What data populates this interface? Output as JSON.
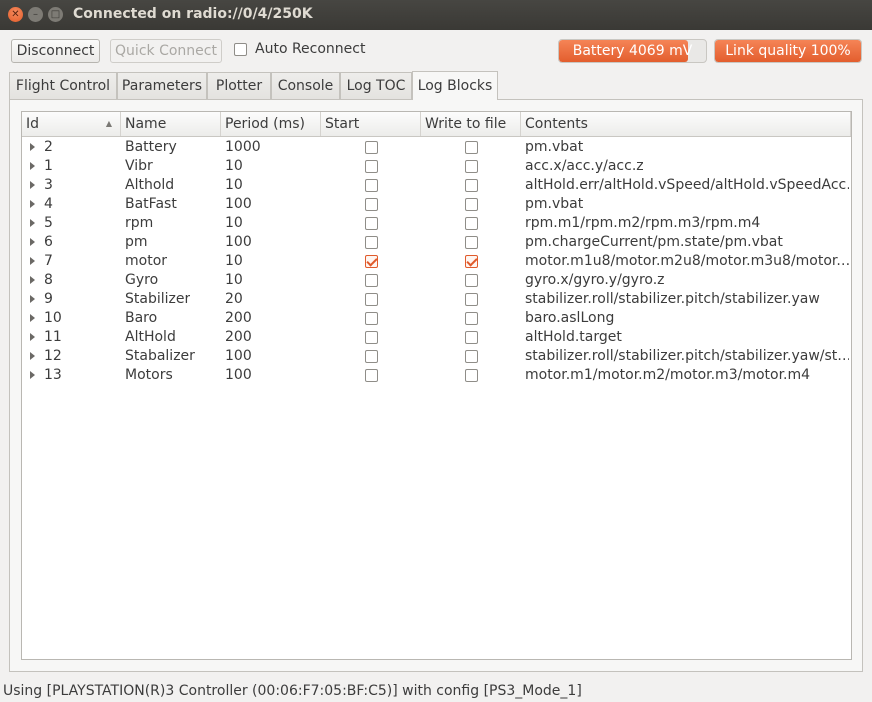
{
  "window": {
    "title": "Connected on radio://0/4/250K"
  },
  "toolbar": {
    "disconnect_label": "Disconnect",
    "quick_connect_label": "Quick Connect",
    "auto_reconnect_label": "Auto Reconnect",
    "auto_reconnect_checked": false,
    "battery_label": "Battery 4069 mV",
    "battery_fraction": 0.88,
    "link_label": "Link quality 100%",
    "link_fraction": 1.0,
    "accent_color": "#e35e2e"
  },
  "tabs": [
    {
      "label": "Flight Control",
      "active": false
    },
    {
      "label": "Parameters",
      "active": false
    },
    {
      "label": "Plotter",
      "active": false
    },
    {
      "label": "Console",
      "active": false
    },
    {
      "label": "Log TOC",
      "active": false
    },
    {
      "label": "Log Blocks",
      "active": true
    }
  ],
  "table": {
    "headers": [
      "Id",
      "Name",
      "Period (ms)",
      "Start",
      "Write to file",
      "Contents"
    ],
    "sort_column": "Id",
    "rows": [
      {
        "id": "2",
        "name": "Battery",
        "period": "1000",
        "start": false,
        "write": false,
        "contents": "pm.vbat"
      },
      {
        "id": "1",
        "name": "Vibr",
        "period": "10",
        "start": false,
        "write": false,
        "contents": "acc.x/acc.y/acc.z"
      },
      {
        "id": "3",
        "name": "Althold",
        "period": "10",
        "start": false,
        "write": false,
        "contents": "altHold.err/altHold.vSpeed/altHold.vSpeedAcc…"
      },
      {
        "id": "4",
        "name": "BatFast",
        "period": "100",
        "start": false,
        "write": false,
        "contents": "pm.vbat"
      },
      {
        "id": "5",
        "name": "rpm",
        "period": "10",
        "start": false,
        "write": false,
        "contents": "rpm.m1/rpm.m2/rpm.m3/rpm.m4"
      },
      {
        "id": "6",
        "name": "pm",
        "period": "100",
        "start": false,
        "write": false,
        "contents": "pm.chargeCurrent/pm.state/pm.vbat"
      },
      {
        "id": "7",
        "name": "motor",
        "period": "10",
        "start": true,
        "write": true,
        "contents": "motor.m1u8/motor.m2u8/motor.m3u8/motor.…"
      },
      {
        "id": "8",
        "name": "Gyro",
        "period": "10",
        "start": false,
        "write": false,
        "contents": "gyro.x/gyro.y/gyro.z"
      },
      {
        "id": "9",
        "name": "Stabilizer",
        "period": "20",
        "start": false,
        "write": false,
        "contents": "stabilizer.roll/stabilizer.pitch/stabilizer.yaw"
      },
      {
        "id": "10",
        "name": "Baro",
        "period": "200",
        "start": false,
        "write": false,
        "contents": "baro.aslLong"
      },
      {
        "id": "11",
        "name": "AltHold",
        "period": "200",
        "start": false,
        "write": false,
        "contents": "altHold.target"
      },
      {
        "id": "12",
        "name": "Stabalizer",
        "period": "100",
        "start": false,
        "write": false,
        "contents": "stabilizer.roll/stabilizer.pitch/stabilizer.yaw/st…"
      },
      {
        "id": "13",
        "name": "Motors",
        "period": "100",
        "start": false,
        "write": false,
        "contents": "motor.m1/motor.m2/motor.m3/motor.m4"
      }
    ]
  },
  "status_bar": {
    "text": "Using [PLAYSTATION(R)3 Controller (00:06:F7:05:BF:C5)] with config [PS3_Mode_1]"
  }
}
